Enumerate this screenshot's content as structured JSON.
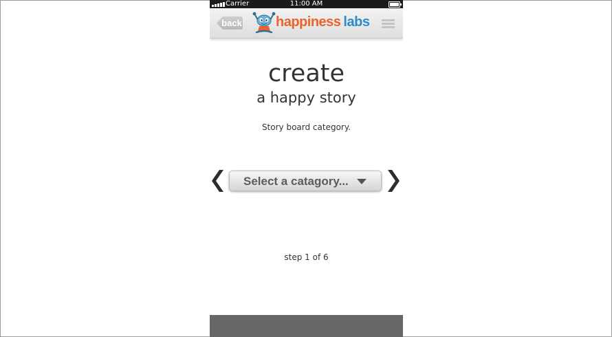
{
  "status_bar": {
    "carrier": "Carrier",
    "time": "11:00 AM"
  },
  "nav": {
    "back_label": "back",
    "logo_word1": "happiness",
    "logo_word2": "labs",
    "logo_icon": "mascot-icon",
    "menu_icon": "hamburger-menu-icon"
  },
  "main": {
    "title": "create",
    "subtitle": "a happy story",
    "category_label": "Story board category.",
    "select_placeholder": "Select a catagory...",
    "step": "step 1 of 6"
  },
  "colors": {
    "logo_orange": "#e9642c",
    "logo_blue": "#2d8bc8",
    "footer": "#676767",
    "text": "#333333"
  }
}
